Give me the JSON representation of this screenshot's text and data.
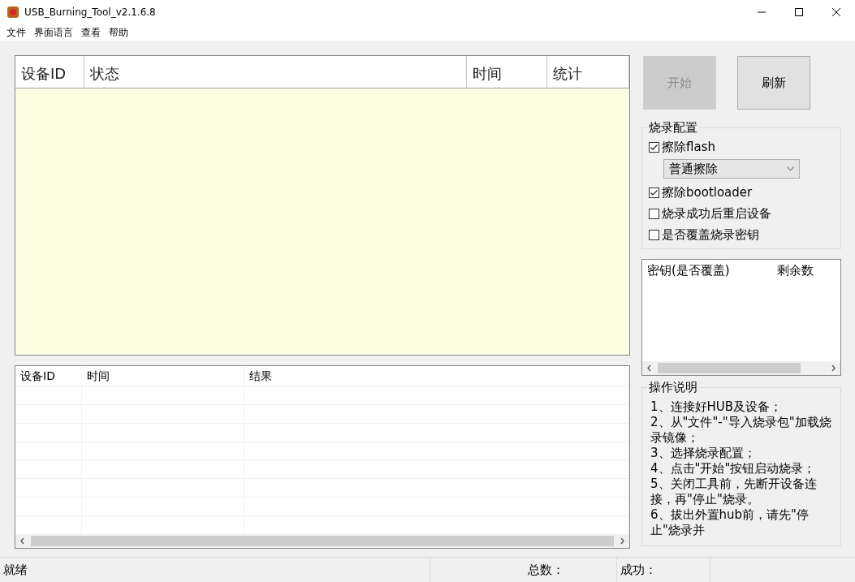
{
  "window": {
    "title": "USB_Burning_Tool_v2.1.6.8"
  },
  "menu": [
    "文件",
    "界面语言",
    "查看",
    "帮助"
  ],
  "device_table": {
    "columns": [
      "设备ID",
      "状态",
      "时间",
      "统计"
    ]
  },
  "result_table": {
    "columns": [
      "设备ID",
      "时间",
      "结果"
    ]
  },
  "buttons": [
    {
      "label": "开始",
      "disabled": true
    },
    {
      "label": "刷新",
      "disabled": false
    }
  ],
  "burn_config": {
    "title": "烧录配置",
    "options": [
      {
        "kind": "checkbox",
        "label": "擦除flash",
        "checked": true
      },
      {
        "kind": "dropdown",
        "value": "普通擦除"
      },
      {
        "kind": "checkbox",
        "label": "擦除bootloader",
        "checked": true
      },
      {
        "kind": "checkbox",
        "label": "烧录成功后重启设备",
        "checked": false
      },
      {
        "kind": "checkbox",
        "label": "是否覆盖烧录密钥",
        "checked": false
      }
    ]
  },
  "key_table": {
    "columns": [
      "密钥(是否覆盖)",
      "剩余数"
    ]
  },
  "instructions": {
    "title": "操作说明",
    "steps": [
      "1、连接好HUB及设备；",
      "2、从\"文件\"-\"导入烧录包\"加载烧录镜像；",
      "3、选择烧录配置；",
      "4、点击\"开始\"按钮启动烧录；",
      "5、关闭工具前，先断开设备连接，再\"停止\"烧录。",
      "6、拔出外置hub前，请先\"停止\"烧录并"
    ]
  },
  "status_bar": [
    "就绪",
    "总数：",
    "成功："
  ]
}
